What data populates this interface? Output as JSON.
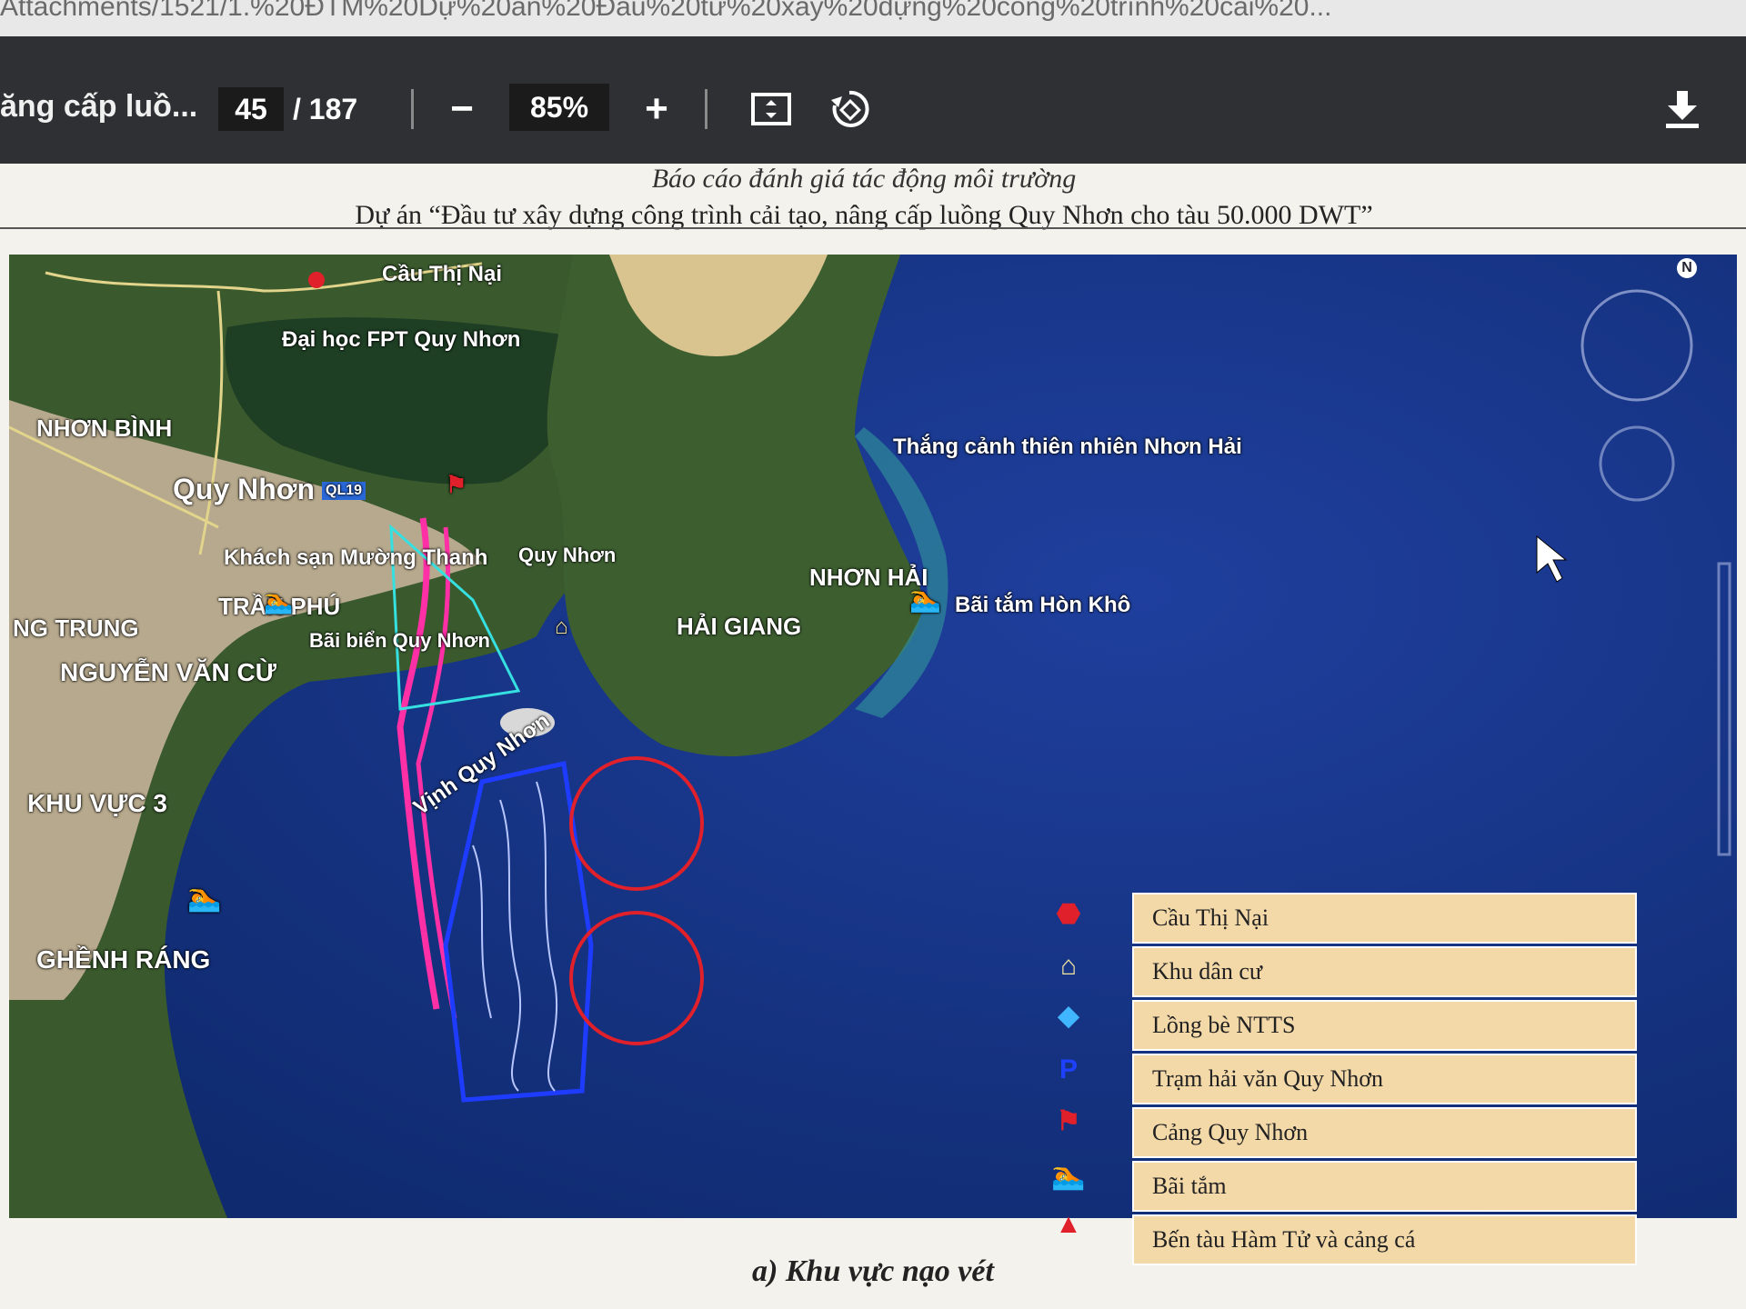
{
  "browser": {
    "url": "Attachments/1521/1.%20ĐTM%20Dự%20án%20Đầu%20tư%20xây%20dựng%20công%20trình%20cải%20..."
  },
  "viewer": {
    "title": "ăng cấp luồ...",
    "page_current": "45",
    "page_total": "/ 187",
    "zoom_out": "−",
    "zoom": "85%",
    "zoom_in": "+"
  },
  "document": {
    "header_italic": "Báo cáo đánh giá tác động môi trường",
    "header_title": "Dự án “Đầu tư xây dựng công trình cải tạo, nâng cấp luồng Quy Nhơn cho tàu 50.000 DWT”",
    "caption": "a) Khu vực nạo vét"
  },
  "map": {
    "compass": "N",
    "labels": {
      "cau_thi_nai": "Cầu Thị Nại",
      "fpt": "Đại học FPT Quy Nhơn",
      "nhon_binh": "NHƠN BÌNH",
      "quy_nhon": "Quy Nhơn",
      "road": "QL19",
      "khach_san": "Khách sạn Mường Thanh",
      "cang_quy_nhon": "Quy Nhơn",
      "tran_phu": "TRẦN PHÚ",
      "ngo_trung": "NG TRUNG",
      "bai_bien": "Bãi biển Quy Nhơn",
      "nguyen_van_cu": "NGUYỄN VĂN CỪ",
      "thang_canh": "Thắng cảnh thiên nhiên Nhơn Hải",
      "nhon_hai": "NHƠN HẢI",
      "hai_giang": "HẢI GIANG",
      "bai_tam_hon_kho": "Bãi tắm Hòn Khô",
      "vinh": "Vịnh Quy Nhơn",
      "khu_vuc_3": "KHU VỰC 3",
      "ghenh_rang": "GHỀNH RÁNG"
    }
  },
  "legend": [
    {
      "label": "Cầu Thị Nại",
      "icon": "bridge-marker-icon",
      "color": "#e0202a"
    },
    {
      "label": "Khu dân cư",
      "icon": "house-icon",
      "color": "#f2e6a0"
    },
    {
      "label": "Lồng bè NTTS",
      "icon": "fish-cage-icon",
      "color": "#3fb6ff"
    },
    {
      "label": "Trạm hải văn Quy Nhơn",
      "icon": "station-p-icon",
      "color": "#1e40ff"
    },
    {
      "label": "Cảng Quy Nhơn",
      "icon": "port-flag-icon",
      "color": "#e0202a"
    },
    {
      "label": "Bãi tắm",
      "icon": "swimmer-icon",
      "color": "#3fb6ff"
    },
    {
      "label": "Bến tàu Hàm Tử và cảng cá",
      "icon": "triangle-icon",
      "color": "#e0202a"
    }
  ]
}
